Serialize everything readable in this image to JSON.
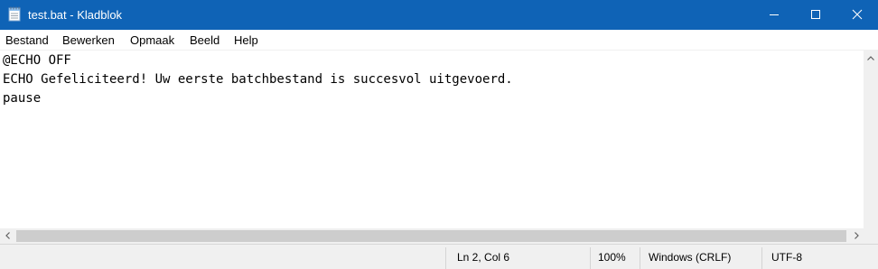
{
  "window": {
    "title": "test.bat - Kladblok",
    "icon": "notepad-icon",
    "controls": [
      "minimize-icon",
      "maximize-icon",
      "close-icon"
    ],
    "accent_color": "#0f63b6"
  },
  "menu": {
    "items": [
      {
        "label": "Bestand"
      },
      {
        "label": "Bewerken"
      },
      {
        "label": "Opmaak"
      },
      {
        "label": "Beeld"
      },
      {
        "label": "Help"
      }
    ]
  },
  "editor": {
    "lines": [
      "@ECHO OFF",
      "ECHO Gefeliciteerd! Uw eerste batchbestand is succesvol uitgevoerd.",
      "pause"
    ]
  },
  "statusbar": {
    "position": "Ln 2, Col 6",
    "zoom": "100%",
    "line_ending": "Windows (CRLF)",
    "encoding": "UTF-8"
  }
}
